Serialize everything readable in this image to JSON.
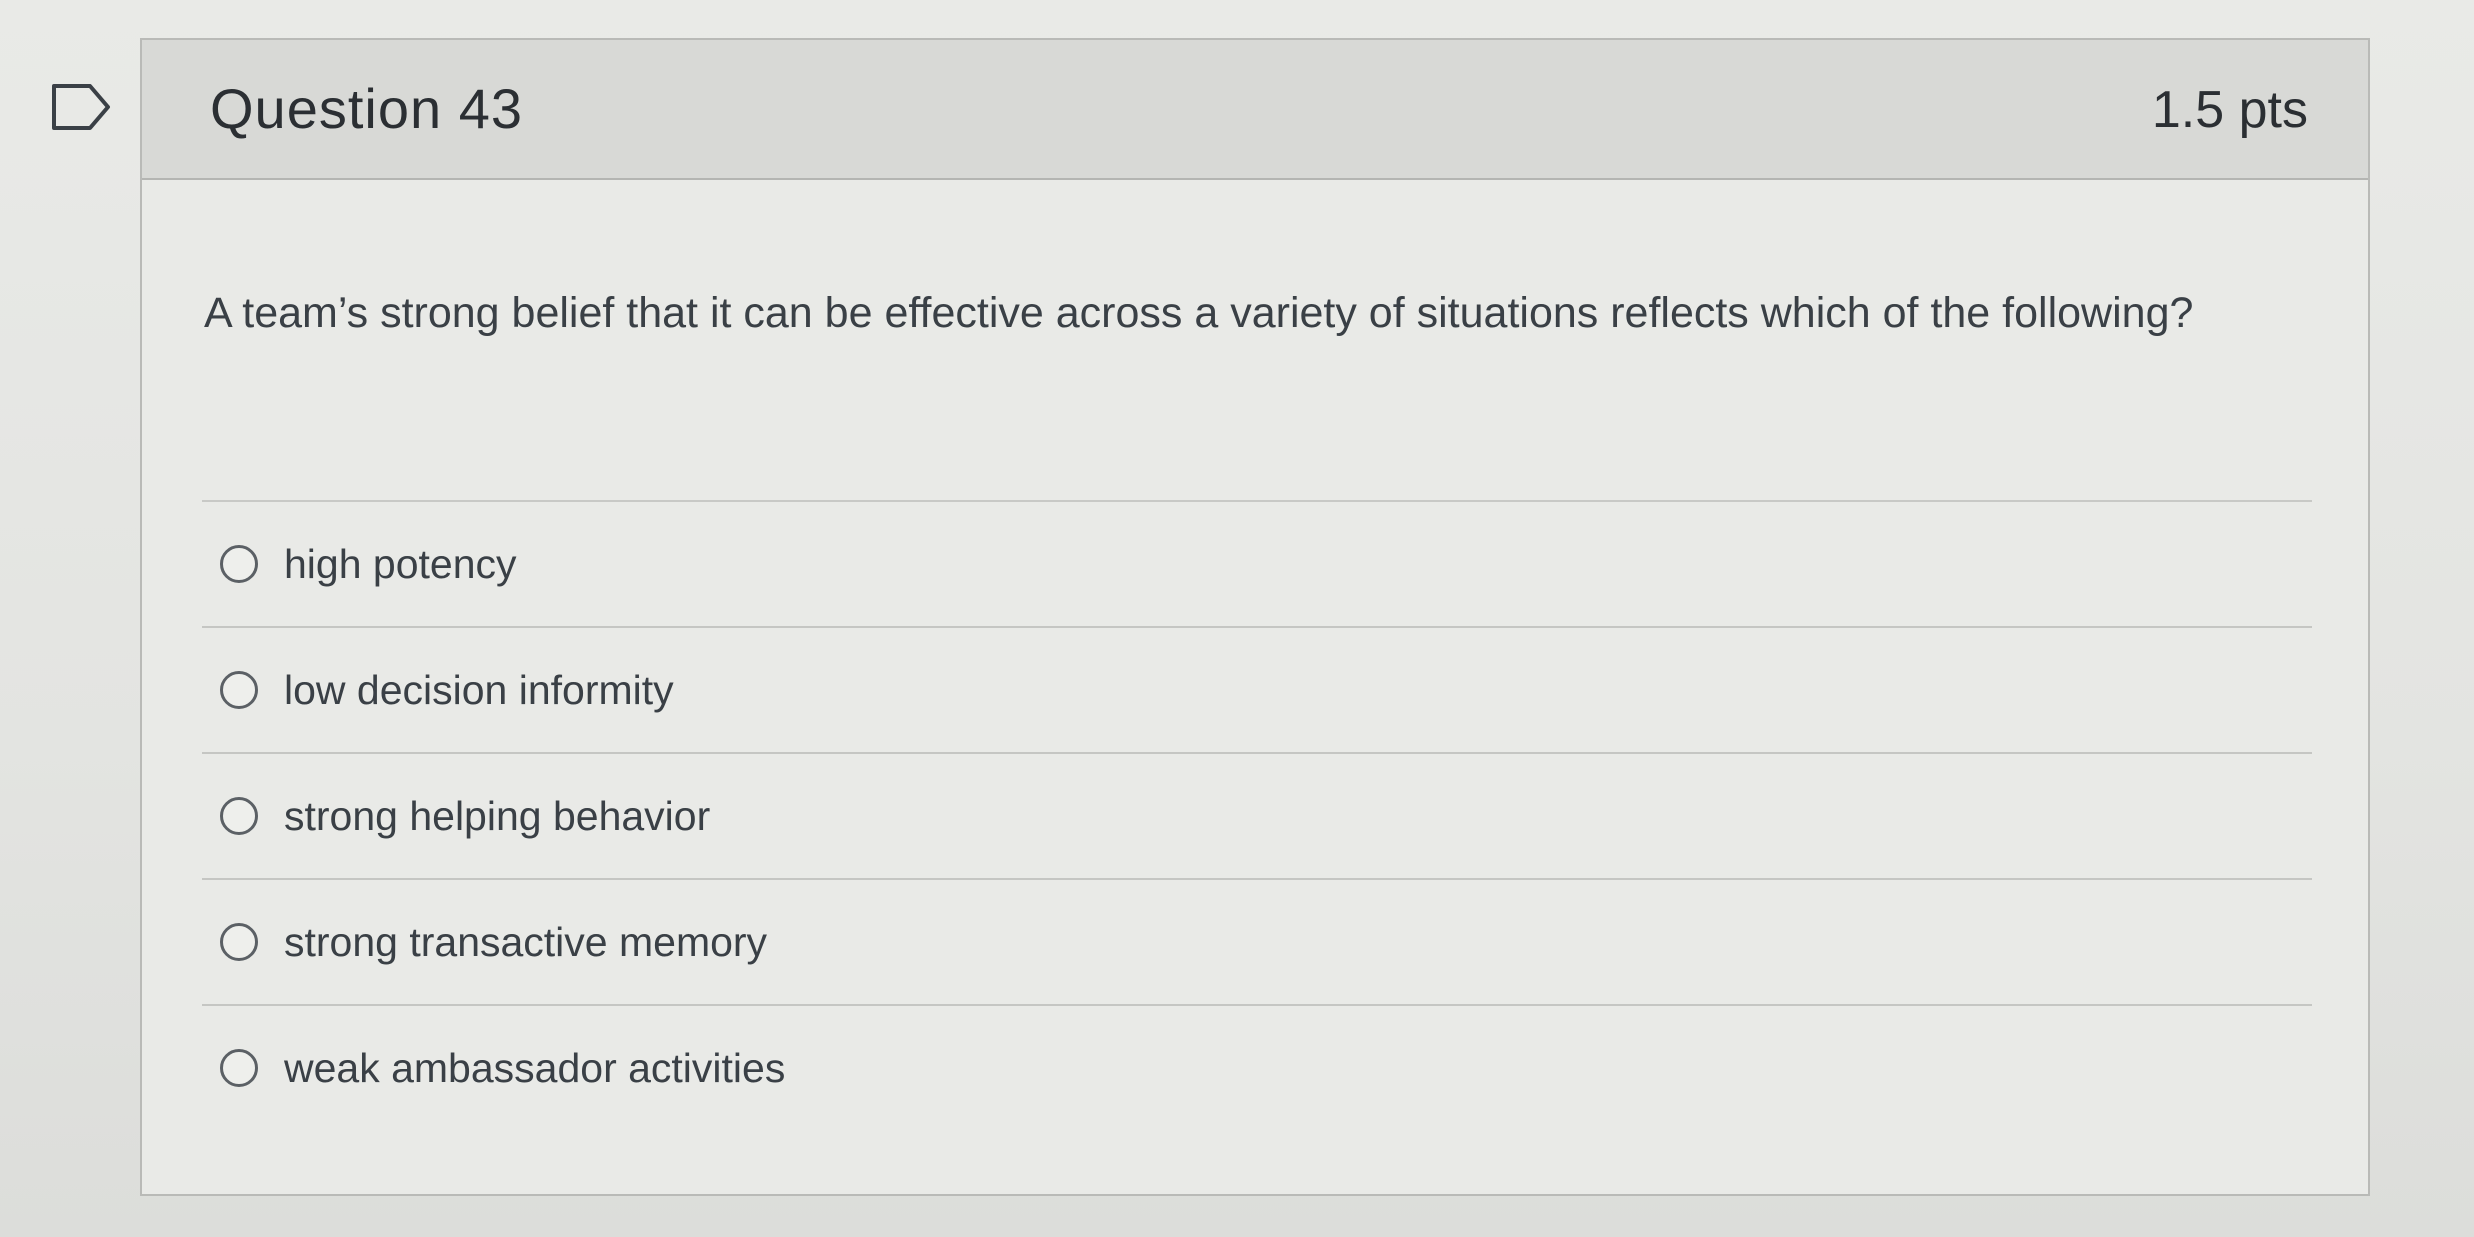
{
  "question": {
    "title": "Question 43",
    "points": "1.5 pts",
    "text": "A team’s strong belief that it can be effective across a variety of situations reflects which of the following?"
  },
  "answers": [
    {
      "label": "high potency"
    },
    {
      "label": "low decision informity"
    },
    {
      "label": "strong helping behavior"
    },
    {
      "label": "strong transactive memory"
    },
    {
      "label": "weak ambassador activities"
    }
  ],
  "colors": {
    "header_bg": "#d8d9d6",
    "card_bg": "#e9eae7",
    "text": "#3a4046"
  },
  "icons": {
    "flag": "flag-question-icon",
    "radio": "radio-button-icon"
  }
}
